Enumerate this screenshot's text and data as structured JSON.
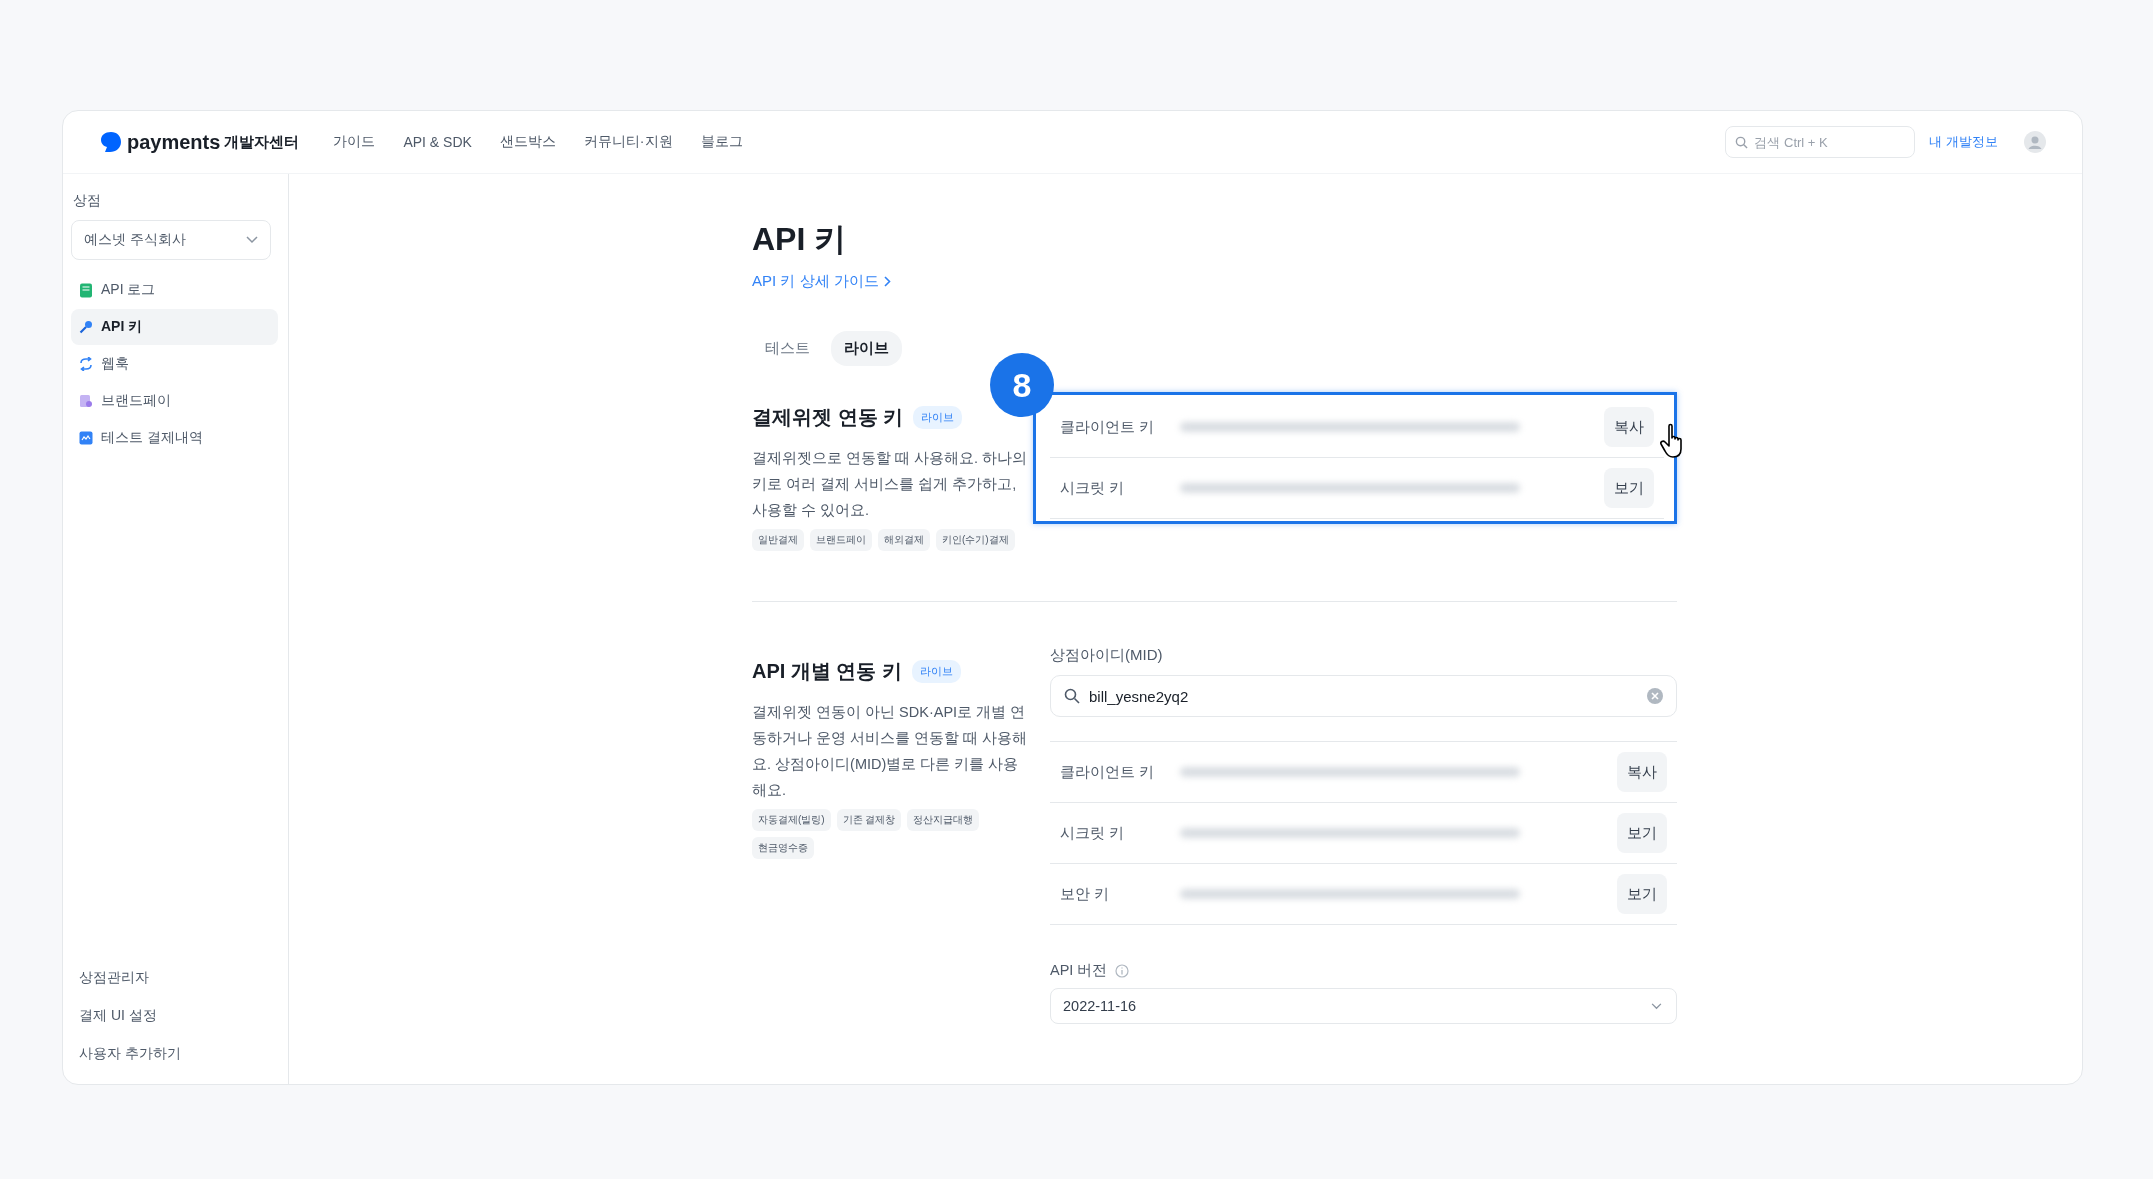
{
  "header": {
    "logo_text": "payments",
    "logo_suffix": "개발자센터",
    "nav": [
      "가이드",
      "API & SDK",
      "샌드박스",
      "커뮤니티·지원",
      "블로그"
    ],
    "search": {
      "placeholder": "검색 Ctrl + K"
    },
    "account_link": "내 개발정보"
  },
  "sidebar": {
    "section_label": "상점",
    "store_select": "예스넷 주식회사",
    "items": [
      {
        "label": "API 로그",
        "kind": "log",
        "selected": false
      },
      {
        "label": "API 키",
        "kind": "key",
        "selected": true
      },
      {
        "label": "웹훅",
        "kind": "sync",
        "selected": false
      },
      {
        "label": "브랜드페이",
        "kind": "brand",
        "selected": false
      },
      {
        "label": "테스트 결제내역",
        "kind": "receipt",
        "selected": false
      }
    ],
    "footer_links": [
      "상점관리자",
      "결제 UI 설정",
      "사용자 추가하기"
    ]
  },
  "main": {
    "title": "API 키",
    "guide_link": "API 키 상세 가이드",
    "tabs": [
      {
        "label": "테스트",
        "selected": false
      },
      {
        "label": "라이브",
        "selected": true
      }
    ],
    "sections": [
      {
        "title": "결제위젯 연동 키",
        "badge": "라이브",
        "description": "결제위젯으로 연동할 때 사용해요. 하나의 키로 여러 결제 서비스를 쉽게 추가하고, 사용할 수 있어요.",
        "tags": [
          "일반결제",
          "브랜드페이",
          "해외결제",
          "키인(수기)결제"
        ],
        "highlighted": true,
        "step_badge": "8",
        "keys": [
          {
            "label": "클라이언트 키",
            "action": "복사",
            "cursor": true
          },
          {
            "label": "시크릿 키",
            "action": "보기",
            "cursor": false
          }
        ]
      },
      {
        "title": "API 개별 연동 키",
        "badge": "라이브",
        "description": "결제위젯 연동이 아닌 SDK·API로 개별 연동하거나 운영 서비스를 연동할 때 사용해요. 상점아이디(MID)별로 다른 키를 사용해요.",
        "tags": [
          "자동결제(빌링)",
          "기존 결제창",
          "정산지급대행",
          "현금영수증"
        ],
        "highlighted": false,
        "mid_field": {
          "label": "상점아이디(MID)",
          "value": "bill_yesne2yq2"
        },
        "keys": [
          {
            "label": "클라이언트 키",
            "action": "복사",
            "cursor": false
          },
          {
            "label": "시크릿 키",
            "action": "보기",
            "cursor": false
          },
          {
            "label": "보안 키",
            "action": "보기",
            "cursor": false
          }
        ],
        "api_version": {
          "label": "API 버전",
          "value": "2022-11-16"
        }
      }
    ]
  }
}
